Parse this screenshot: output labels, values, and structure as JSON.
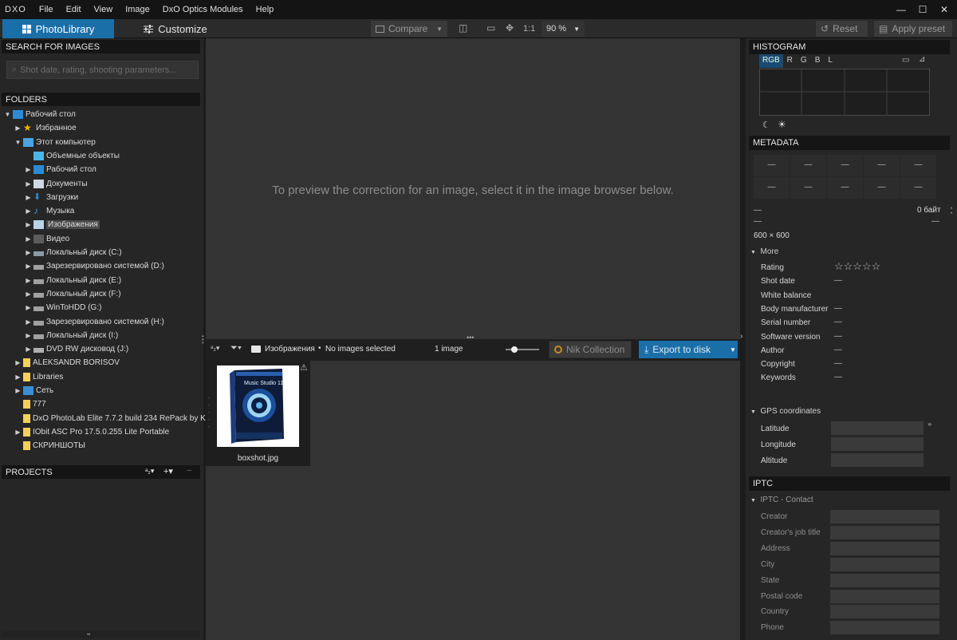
{
  "menubar": {
    "logo": "DXO",
    "items": [
      "File",
      "Edit",
      "View",
      "Image",
      "DxO Optics Modules",
      "Help"
    ]
  },
  "toolbar": {
    "photolibrary": "PhotoLibrary",
    "customize": "Customize",
    "compare": "Compare",
    "one_to_one": "1:1",
    "zoom": "90 %",
    "reset": "Reset",
    "apply_preset": "Apply preset"
  },
  "left": {
    "search_header": "SEARCH FOR IMAGES",
    "search_placeholder": "Shot date, rating, shooting parameters...",
    "folders_header": "FOLDERS",
    "projects_header": "PROJECTS",
    "tree": [
      {
        "label": "Рабочий стол",
        "indent": 0,
        "arrow": "▼",
        "icon": "desktop"
      },
      {
        "label": "Избранное",
        "indent": 1,
        "arrow": "▶",
        "icon": "star"
      },
      {
        "label": "Этот компьютер",
        "indent": 1,
        "arrow": "▼",
        "icon": "pc"
      },
      {
        "label": "Объемные объекты",
        "indent": 2,
        "arrow": "",
        "icon": "cube"
      },
      {
        "label": "Рабочий стол",
        "indent": 2,
        "arrow": "▶",
        "icon": "desktop"
      },
      {
        "label": "Документы",
        "indent": 2,
        "arrow": "▶",
        "icon": "doc"
      },
      {
        "label": "Загрузки",
        "indent": 2,
        "arrow": "▶",
        "icon": "down"
      },
      {
        "label": "Музыка",
        "indent": 2,
        "arrow": "▶",
        "icon": "music"
      },
      {
        "label": "Изображения",
        "indent": 2,
        "arrow": "▶",
        "icon": "pic",
        "selected": true
      },
      {
        "label": "Видео",
        "indent": 2,
        "arrow": "▶",
        "icon": "video"
      },
      {
        "label": "Локальный диск (C:)",
        "indent": 2,
        "arrow": "▶",
        "icon": "sysdrive"
      },
      {
        "label": "Зарезервировано системой (D:)",
        "indent": 2,
        "arrow": "▶",
        "icon": "drive"
      },
      {
        "label": "Локальный диск (E:)",
        "indent": 2,
        "arrow": "▶",
        "icon": "drive"
      },
      {
        "label": "Локальный диск (F:)",
        "indent": 2,
        "arrow": "▶",
        "icon": "drive"
      },
      {
        "label": "WinToHDD (G:)",
        "indent": 2,
        "arrow": "▶",
        "icon": "drive"
      },
      {
        "label": "Зарезервировано системой (H:)",
        "indent": 2,
        "arrow": "▶",
        "icon": "drive"
      },
      {
        "label": "Локальный диск (I:)",
        "indent": 2,
        "arrow": "▶",
        "icon": "drive"
      },
      {
        "label": "DVD RW дисковод (J:)",
        "indent": 2,
        "arrow": "▶",
        "icon": "dvd"
      },
      {
        "label": "ALEKSANDR BORISOV",
        "indent": 1,
        "arrow": "▶",
        "icon": "folder"
      },
      {
        "label": "Libraries",
        "indent": 1,
        "arrow": "▶",
        "icon": "folder"
      },
      {
        "label": "Сеть",
        "indent": 1,
        "arrow": "▶",
        "icon": "net"
      },
      {
        "label": "777",
        "indent": 1,
        "arrow": "",
        "icon": "folder"
      },
      {
        "label": "DxO PhotoLab Elite 7.7.2 build 234 RePack by K",
        "indent": 1,
        "arrow": "",
        "icon": "folder"
      },
      {
        "label": "IObit ASC Pro 17.5.0.255 Lite Portable",
        "indent": 1,
        "arrow": "▶",
        "icon": "folder"
      },
      {
        "label": "СКРИНШОТЫ",
        "indent": 1,
        "arrow": "",
        "icon": "folder"
      }
    ]
  },
  "center": {
    "preview_message": "To preview the correction for an image, select it in the image browser below.",
    "path": "Изображения",
    "selection": "No images selected",
    "count": "1 image",
    "nik": "Nik Collection",
    "export": "Export to disk",
    "thumb_label": "boxshot.jpg",
    "box_brand": "Music Studio 11"
  },
  "right": {
    "histogram_header": "HISTOGRAM",
    "channels": [
      "RGB",
      "R",
      "G",
      "B",
      "L"
    ],
    "metadata_header": "METADATA",
    "dash": "—",
    "filesize": "0 байт",
    "dimensions": "600 × 600",
    "more": "More",
    "rows": [
      {
        "label": "Rating",
        "value": "☆☆☆☆☆"
      },
      {
        "label": "Shot date",
        "value": "—"
      },
      {
        "label": "White balance",
        "value": ""
      },
      {
        "label": "Body manufacturer",
        "value": "—"
      },
      {
        "label": "Serial number",
        "value": "—"
      },
      {
        "label": "Software version",
        "value": "—"
      },
      {
        "label": "Author",
        "value": "—"
      },
      {
        "label": "Copyright",
        "value": "—"
      },
      {
        "label": "Keywords",
        "value": "—"
      }
    ],
    "gps_header": "GPS coordinates",
    "gps": [
      "Latitude",
      "Longitude",
      "Altitude"
    ],
    "iptc_header": "IPTC",
    "iptc_contact": "IPTC - Contact",
    "iptc_fields": [
      "Creator",
      "Creator's job title",
      "Address",
      "City",
      "State",
      "Postal code",
      "Country",
      "Phone"
    ]
  }
}
